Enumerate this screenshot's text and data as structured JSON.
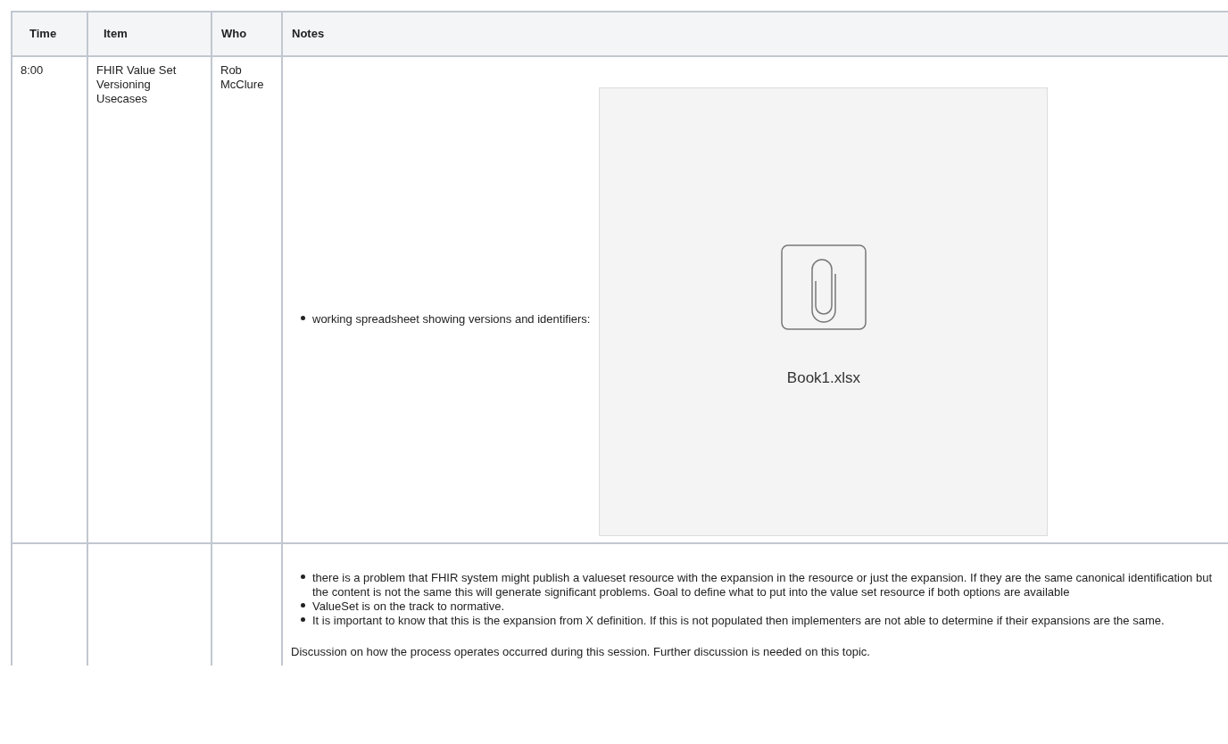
{
  "table": {
    "columns": [
      "Time",
      "Item",
      "Who",
      "Notes"
    ],
    "rows": [
      {
        "time": "8:00",
        "item": "FHIR Value Set Versioning Usecases",
        "who": "Rob McClure",
        "notes": [
          {
            "kind": "list",
            "items": [
              {
                "text": "working spreadsheet showing versions and identifiers:",
                "attachment": "Book1.xlsx"
              }
            ]
          }
        ]
      },
      {
        "notes": [
          {
            "kind": "list",
            "items": [
              {
                "text": "there is a problem that FHIR system might publish a valueset resource with the expansion in the resource or just the expansion. If they are the same canonical identification but the content is not the same this will generate significant problems. Goal to define what to put into the value set resource if both options are available"
              },
              {
                "text": "ValueSet is on the track to normative."
              },
              {
                "text": "It is important to know that this is the expansion from X definition. If this is not populated then implementers are not able to determine if their expansions are the same."
              }
            ]
          },
          {
            "kind": "paragraph",
            "text": "Discussion on how the process operates occurred during this session. Further discussion is needed on this topic."
          }
        ]
      }
    ]
  }
}
